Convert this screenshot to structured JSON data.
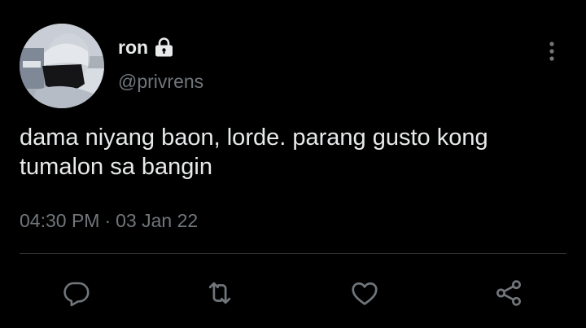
{
  "author": {
    "display_name": "ron",
    "handle": "@privrens",
    "protected_icon": "lock-icon",
    "avatar": "profile-photo"
  },
  "tweet": {
    "text": "dama niyang baon, lorde. parang gusto kong tumalon sa bangin",
    "time": "04:30 PM",
    "separator": "·",
    "date": "03 Jan 22"
  },
  "menu_icon": "more-vertical-icon",
  "actions": [
    {
      "icon": "reply-icon"
    },
    {
      "icon": "retweet-icon"
    },
    {
      "icon": "like-icon"
    },
    {
      "icon": "share-icon"
    }
  ],
  "colors": {
    "background": "#000000",
    "text_primary": "#e7e9ea",
    "text_secondary": "#71767b",
    "divider": "#2f3336"
  }
}
